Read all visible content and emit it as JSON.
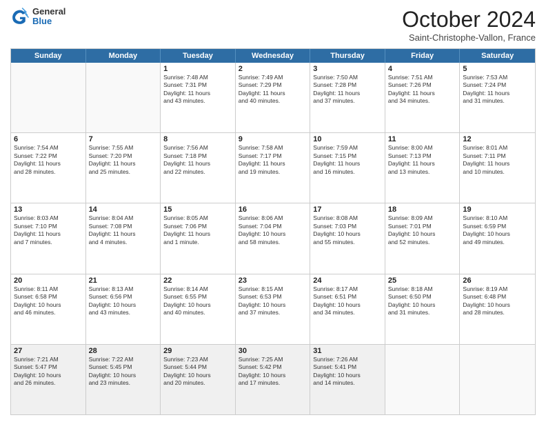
{
  "header": {
    "logo_general": "General",
    "logo_blue": "Blue",
    "month_title": "October 2024",
    "location": "Saint-Christophe-Vallon, France"
  },
  "days_of_week": [
    "Sunday",
    "Monday",
    "Tuesday",
    "Wednesday",
    "Thursday",
    "Friday",
    "Saturday"
  ],
  "weeks": [
    [
      {
        "day": "",
        "empty": true
      },
      {
        "day": "",
        "empty": true
      },
      {
        "day": "1",
        "line1": "Sunrise: 7:48 AM",
        "line2": "Sunset: 7:31 PM",
        "line3": "Daylight: 11 hours",
        "line4": "and 43 minutes."
      },
      {
        "day": "2",
        "line1": "Sunrise: 7:49 AM",
        "line2": "Sunset: 7:29 PM",
        "line3": "Daylight: 11 hours",
        "line4": "and 40 minutes."
      },
      {
        "day": "3",
        "line1": "Sunrise: 7:50 AM",
        "line2": "Sunset: 7:28 PM",
        "line3": "Daylight: 11 hours",
        "line4": "and 37 minutes."
      },
      {
        "day": "4",
        "line1": "Sunrise: 7:51 AM",
        "line2": "Sunset: 7:26 PM",
        "line3": "Daylight: 11 hours",
        "line4": "and 34 minutes."
      },
      {
        "day": "5",
        "line1": "Sunrise: 7:53 AM",
        "line2": "Sunset: 7:24 PM",
        "line3": "Daylight: 11 hours",
        "line4": "and 31 minutes."
      }
    ],
    [
      {
        "day": "6",
        "line1": "Sunrise: 7:54 AM",
        "line2": "Sunset: 7:22 PM",
        "line3": "Daylight: 11 hours",
        "line4": "and 28 minutes."
      },
      {
        "day": "7",
        "line1": "Sunrise: 7:55 AM",
        "line2": "Sunset: 7:20 PM",
        "line3": "Daylight: 11 hours",
        "line4": "and 25 minutes."
      },
      {
        "day": "8",
        "line1": "Sunrise: 7:56 AM",
        "line2": "Sunset: 7:18 PM",
        "line3": "Daylight: 11 hours",
        "line4": "and 22 minutes."
      },
      {
        "day": "9",
        "line1": "Sunrise: 7:58 AM",
        "line2": "Sunset: 7:17 PM",
        "line3": "Daylight: 11 hours",
        "line4": "and 19 minutes."
      },
      {
        "day": "10",
        "line1": "Sunrise: 7:59 AM",
        "line2": "Sunset: 7:15 PM",
        "line3": "Daylight: 11 hours",
        "line4": "and 16 minutes."
      },
      {
        "day": "11",
        "line1": "Sunrise: 8:00 AM",
        "line2": "Sunset: 7:13 PM",
        "line3": "Daylight: 11 hours",
        "line4": "and 13 minutes."
      },
      {
        "day": "12",
        "line1": "Sunrise: 8:01 AM",
        "line2": "Sunset: 7:11 PM",
        "line3": "Daylight: 11 hours",
        "line4": "and 10 minutes."
      }
    ],
    [
      {
        "day": "13",
        "line1": "Sunrise: 8:03 AM",
        "line2": "Sunset: 7:10 PM",
        "line3": "Daylight: 11 hours",
        "line4": "and 7 minutes."
      },
      {
        "day": "14",
        "line1": "Sunrise: 8:04 AM",
        "line2": "Sunset: 7:08 PM",
        "line3": "Daylight: 11 hours",
        "line4": "and 4 minutes."
      },
      {
        "day": "15",
        "line1": "Sunrise: 8:05 AM",
        "line2": "Sunset: 7:06 PM",
        "line3": "Daylight: 11 hours",
        "line4": "and 1 minute."
      },
      {
        "day": "16",
        "line1": "Sunrise: 8:06 AM",
        "line2": "Sunset: 7:04 PM",
        "line3": "Daylight: 10 hours",
        "line4": "and 58 minutes."
      },
      {
        "day": "17",
        "line1": "Sunrise: 8:08 AM",
        "line2": "Sunset: 7:03 PM",
        "line3": "Daylight: 10 hours",
        "line4": "and 55 minutes."
      },
      {
        "day": "18",
        "line1": "Sunrise: 8:09 AM",
        "line2": "Sunset: 7:01 PM",
        "line3": "Daylight: 10 hours",
        "line4": "and 52 minutes."
      },
      {
        "day": "19",
        "line1": "Sunrise: 8:10 AM",
        "line2": "Sunset: 6:59 PM",
        "line3": "Daylight: 10 hours",
        "line4": "and 49 minutes."
      }
    ],
    [
      {
        "day": "20",
        "line1": "Sunrise: 8:11 AM",
        "line2": "Sunset: 6:58 PM",
        "line3": "Daylight: 10 hours",
        "line4": "and 46 minutes."
      },
      {
        "day": "21",
        "line1": "Sunrise: 8:13 AM",
        "line2": "Sunset: 6:56 PM",
        "line3": "Daylight: 10 hours",
        "line4": "and 43 minutes."
      },
      {
        "day": "22",
        "line1": "Sunrise: 8:14 AM",
        "line2": "Sunset: 6:55 PM",
        "line3": "Daylight: 10 hours",
        "line4": "and 40 minutes."
      },
      {
        "day": "23",
        "line1": "Sunrise: 8:15 AM",
        "line2": "Sunset: 6:53 PM",
        "line3": "Daylight: 10 hours",
        "line4": "and 37 minutes."
      },
      {
        "day": "24",
        "line1": "Sunrise: 8:17 AM",
        "line2": "Sunset: 6:51 PM",
        "line3": "Daylight: 10 hours",
        "line4": "and 34 minutes."
      },
      {
        "day": "25",
        "line1": "Sunrise: 8:18 AM",
        "line2": "Sunset: 6:50 PM",
        "line3": "Daylight: 10 hours",
        "line4": "and 31 minutes."
      },
      {
        "day": "26",
        "line1": "Sunrise: 8:19 AM",
        "line2": "Sunset: 6:48 PM",
        "line3": "Daylight: 10 hours",
        "line4": "and 28 minutes."
      }
    ],
    [
      {
        "day": "27",
        "line1": "Sunrise: 7:21 AM",
        "line2": "Sunset: 5:47 PM",
        "line3": "Daylight: 10 hours",
        "line4": "and 26 minutes."
      },
      {
        "day": "28",
        "line1": "Sunrise: 7:22 AM",
        "line2": "Sunset: 5:45 PM",
        "line3": "Daylight: 10 hours",
        "line4": "and 23 minutes."
      },
      {
        "day": "29",
        "line1": "Sunrise: 7:23 AM",
        "line2": "Sunset: 5:44 PM",
        "line3": "Daylight: 10 hours",
        "line4": "and 20 minutes."
      },
      {
        "day": "30",
        "line1": "Sunrise: 7:25 AM",
        "line2": "Sunset: 5:42 PM",
        "line3": "Daylight: 10 hours",
        "line4": "and 17 minutes."
      },
      {
        "day": "31",
        "line1": "Sunrise: 7:26 AM",
        "line2": "Sunset: 5:41 PM",
        "line3": "Daylight: 10 hours",
        "line4": "and 14 minutes."
      },
      {
        "day": "",
        "empty": true
      },
      {
        "day": "",
        "empty": true
      }
    ]
  ]
}
